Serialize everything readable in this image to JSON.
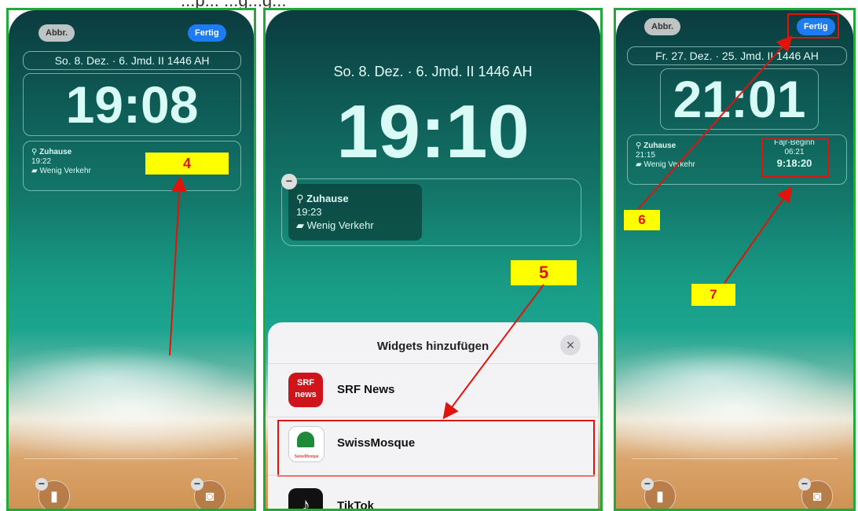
{
  "header_fragment": "...p... ...g...g...",
  "panel1": {
    "cancel_label": "Abbr.",
    "done_label": "Fertig",
    "date": "So. 8. Dez. · 6. Jmd. II 1446 AH",
    "time": "19:08",
    "widget": {
      "place": "Zuhause",
      "time": "19:22",
      "traffic": "Wenig Verkehr"
    },
    "step": "4"
  },
  "panel2": {
    "date": "So. 8. Dez. · 6. Jmd. II 1446 AH",
    "time": "19:10",
    "widget": {
      "place": "Zuhause",
      "time": "19:23",
      "traffic": "Wenig Verkehr"
    },
    "step": "5",
    "sheet": {
      "title": "Widgets hinzufügen",
      "close": "×",
      "apps": [
        {
          "name": "SRF News",
          "icon_text_top": "SRF",
          "icon_text_bottom": "news"
        },
        {
          "name": "SwissMosque",
          "icon_text": "SwissMosque"
        },
        {
          "name": "TikTok"
        }
      ]
    }
  },
  "panel3": {
    "cancel_label": "Abbr.",
    "done_label": "Fertig",
    "date": "Fr. 27. Dez. · 25. Jmd. II 1446 AH",
    "time": "21:01",
    "widget": {
      "place": "Zuhause",
      "time": "21:15",
      "traffic": "Wenig Verkehr"
    },
    "prayer": {
      "label": "Fajr-Beginn",
      "time": "06:21",
      "countdown": "9:18:20"
    },
    "steps": [
      "6",
      "7"
    ]
  },
  "colors": {
    "frame": "#1faa3a",
    "highlight": "#e0140b",
    "tag_bg": "#ffff00",
    "button_blue": "#1e7cf2"
  },
  "icons": [
    "location-pin-icon",
    "car-icon",
    "flashlight-icon",
    "camera-icon",
    "minus-icon",
    "close-icon",
    "srf-news-icon",
    "swissmosque-icon",
    "tiktok-icon"
  ]
}
